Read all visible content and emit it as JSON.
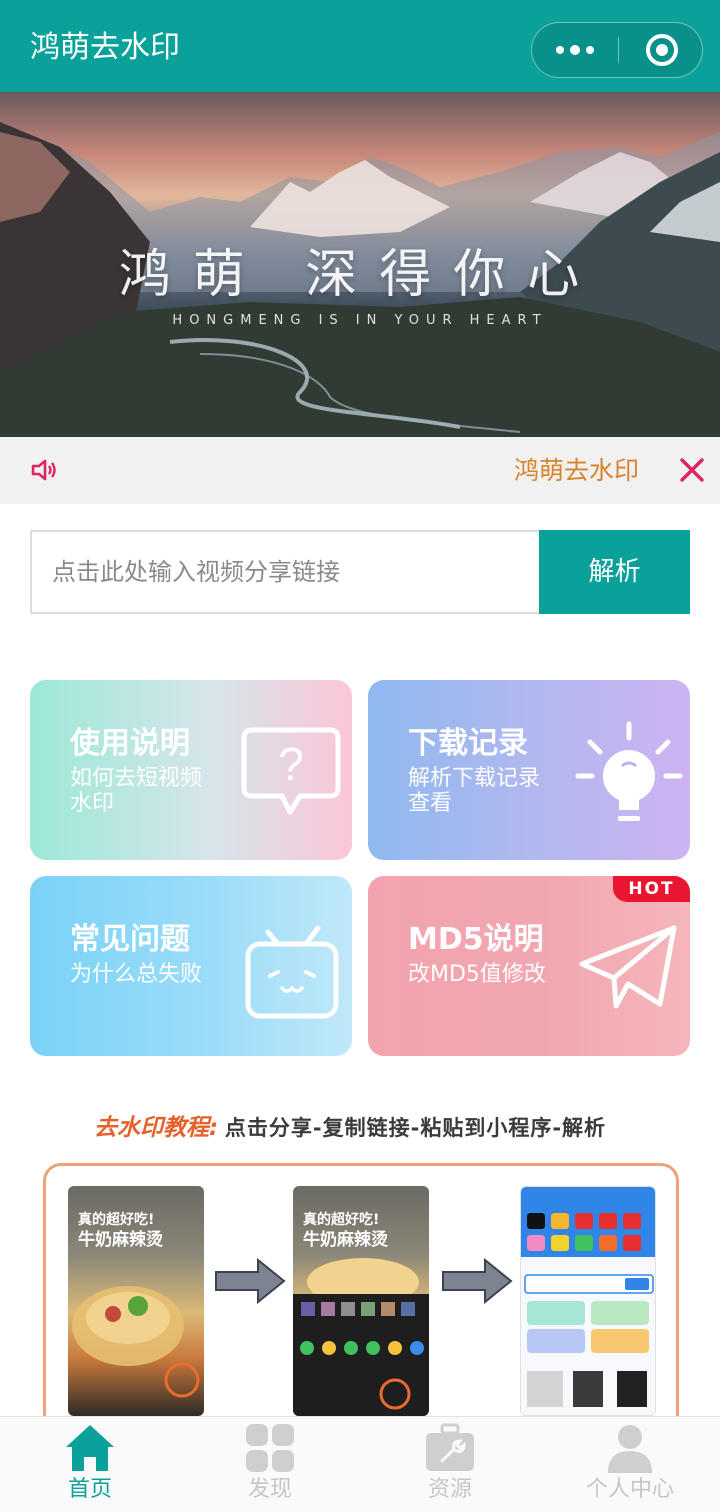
{
  "header": {
    "title": "鸿萌去水印"
  },
  "banner": {
    "title": "鸿萌 深得你心",
    "subtitle": "HONGMENG IS IN YOUR HEART"
  },
  "notice": {
    "text": "鸿萌去水印"
  },
  "search": {
    "placeholder": "点击此处输入视频分享链接",
    "button_label": "解析"
  },
  "cards": [
    {
      "title": "使用说明",
      "desc": "如何去短视频水印",
      "icon": "question-bubble-icon"
    },
    {
      "title": "下载记录",
      "desc": "解析下载记录查看",
      "icon": "lightbulb-icon"
    },
    {
      "title": "常见问题",
      "desc": "为什么总失败",
      "icon": "tv-face-icon"
    },
    {
      "title": "MD5说明",
      "desc": "改MD5值修改",
      "icon": "paper-plane-icon",
      "badge": "HOT"
    }
  ],
  "tutorial": {
    "label": "去水印教程:",
    "steps": "点击分享-复制链接-粘贴到小程序-解析",
    "phone_caption_line1": "真的超好吃!",
    "phone_caption_line2": "牛奶麻辣烫"
  },
  "tabbar": {
    "items": [
      {
        "label": "首页",
        "icon": "home-icon",
        "active": true
      },
      {
        "label": "发现",
        "icon": "grid-icon",
        "active": false
      },
      {
        "label": "资源",
        "icon": "toolbox-icon",
        "active": false
      },
      {
        "label": "个人中心",
        "icon": "user-icon",
        "active": false
      }
    ]
  },
  "colors": {
    "primary": "#0aa19b",
    "notice_text": "#d9822b",
    "close_red": "#e0245e",
    "hot_red": "#e8162f",
    "tab_inactive": "#c6c6c6"
  }
}
